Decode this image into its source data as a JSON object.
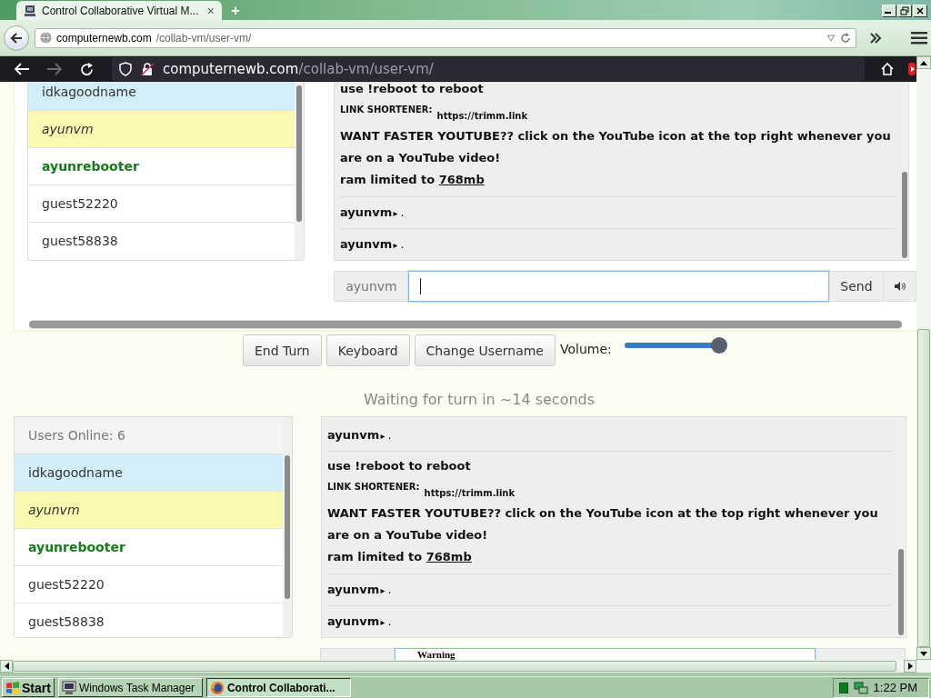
{
  "browser": {
    "tab": {
      "title": "Control Collaborative Virtual M...",
      "selected": true
    },
    "tab_close": "×",
    "new_tab": "+",
    "address": {
      "host": "computernewb.com",
      "path": "/collab-vm/user-vm/"
    }
  },
  "vm_browser": {
    "address": {
      "host": "computernewb.com",
      "path": "/collab-vm/user-vm/"
    }
  },
  "top_panel": {
    "users": [
      {
        "name": "idkagoodname",
        "kind": "turn"
      },
      {
        "name": "ayunvm",
        "kind": "waiting"
      },
      {
        "name": "ayunrebooter",
        "kind": "admin"
      },
      {
        "name": "guest52220",
        "kind": "user"
      },
      {
        "name": "guest58838",
        "kind": "user"
      }
    ],
    "messages": [
      {
        "kind": "system",
        "lines": [
          {
            "kind": "text",
            "text": "use !reboot to reboot"
          },
          {
            "kind": "label-link",
            "label": "LINK SHORTENER:",
            "link": "https://trimm.link"
          },
          {
            "kind": "text",
            "text": "WANT FASTER YOUTUBE?? click on the YouTube icon at the top right whenever you are on a YouTube video!"
          },
          {
            "kind": "text-link",
            "text": "ram limited to",
            "link": "768mb"
          }
        ]
      },
      {
        "kind": "chat",
        "user": "ayunvm",
        "separator": "▸",
        "text": "."
      },
      {
        "kind": "chat",
        "user": "ayunvm",
        "separator": "▸",
        "text": "."
      }
    ],
    "chat_input": {
      "username": "ayunvm",
      "send": "Send"
    }
  },
  "controls": {
    "buttons": [
      "End Turn",
      "Keyboard",
      "Change Username"
    ],
    "volume": {
      "label": "Volume:",
      "level": 0.95
    }
  },
  "turn_status": "Waiting for turn in ~14 seconds",
  "bottom_panel": {
    "users_header": "Users Online: 6",
    "users": [
      {
        "name": "idkagoodname",
        "kind": "turn"
      },
      {
        "name": "ayunvm",
        "kind": "waiting"
      },
      {
        "name": "ayunrebooter",
        "kind": "admin"
      },
      {
        "name": "guest52220",
        "kind": "user"
      },
      {
        "name": "guest58838",
        "kind": "user"
      }
    ],
    "messages": [
      {
        "kind": "chat",
        "user": "ayunvm",
        "separator": "▸",
        "text": "."
      },
      {
        "kind": "system",
        "lines": [
          {
            "kind": "text",
            "text": "use !reboot to reboot"
          },
          {
            "kind": "label-link",
            "label": "LINK SHORTENER:",
            "link": "https://trimm.link"
          },
          {
            "kind": "text",
            "text": "WANT FASTER YOUTUBE?? click on the YouTube icon at the top right whenever you are on a YouTube video!"
          },
          {
            "kind": "text-link",
            "text": "ram limited to",
            "link": "768mb"
          }
        ]
      },
      {
        "kind": "chat",
        "user": "ayunvm",
        "separator": "▸",
        "text": "."
      },
      {
        "kind": "chat",
        "user": "ayunvm",
        "separator": "▸",
        "text": "."
      }
    ]
  },
  "partial_row": {
    "text": "Warning"
  },
  "taskbar": {
    "start": "Start",
    "tasks": [
      {
        "label": "Windows Task Manager",
        "selected": false
      },
      {
        "label": "Control Collaborati...",
        "selected": true
      }
    ],
    "clock": "1:22 PM"
  }
}
